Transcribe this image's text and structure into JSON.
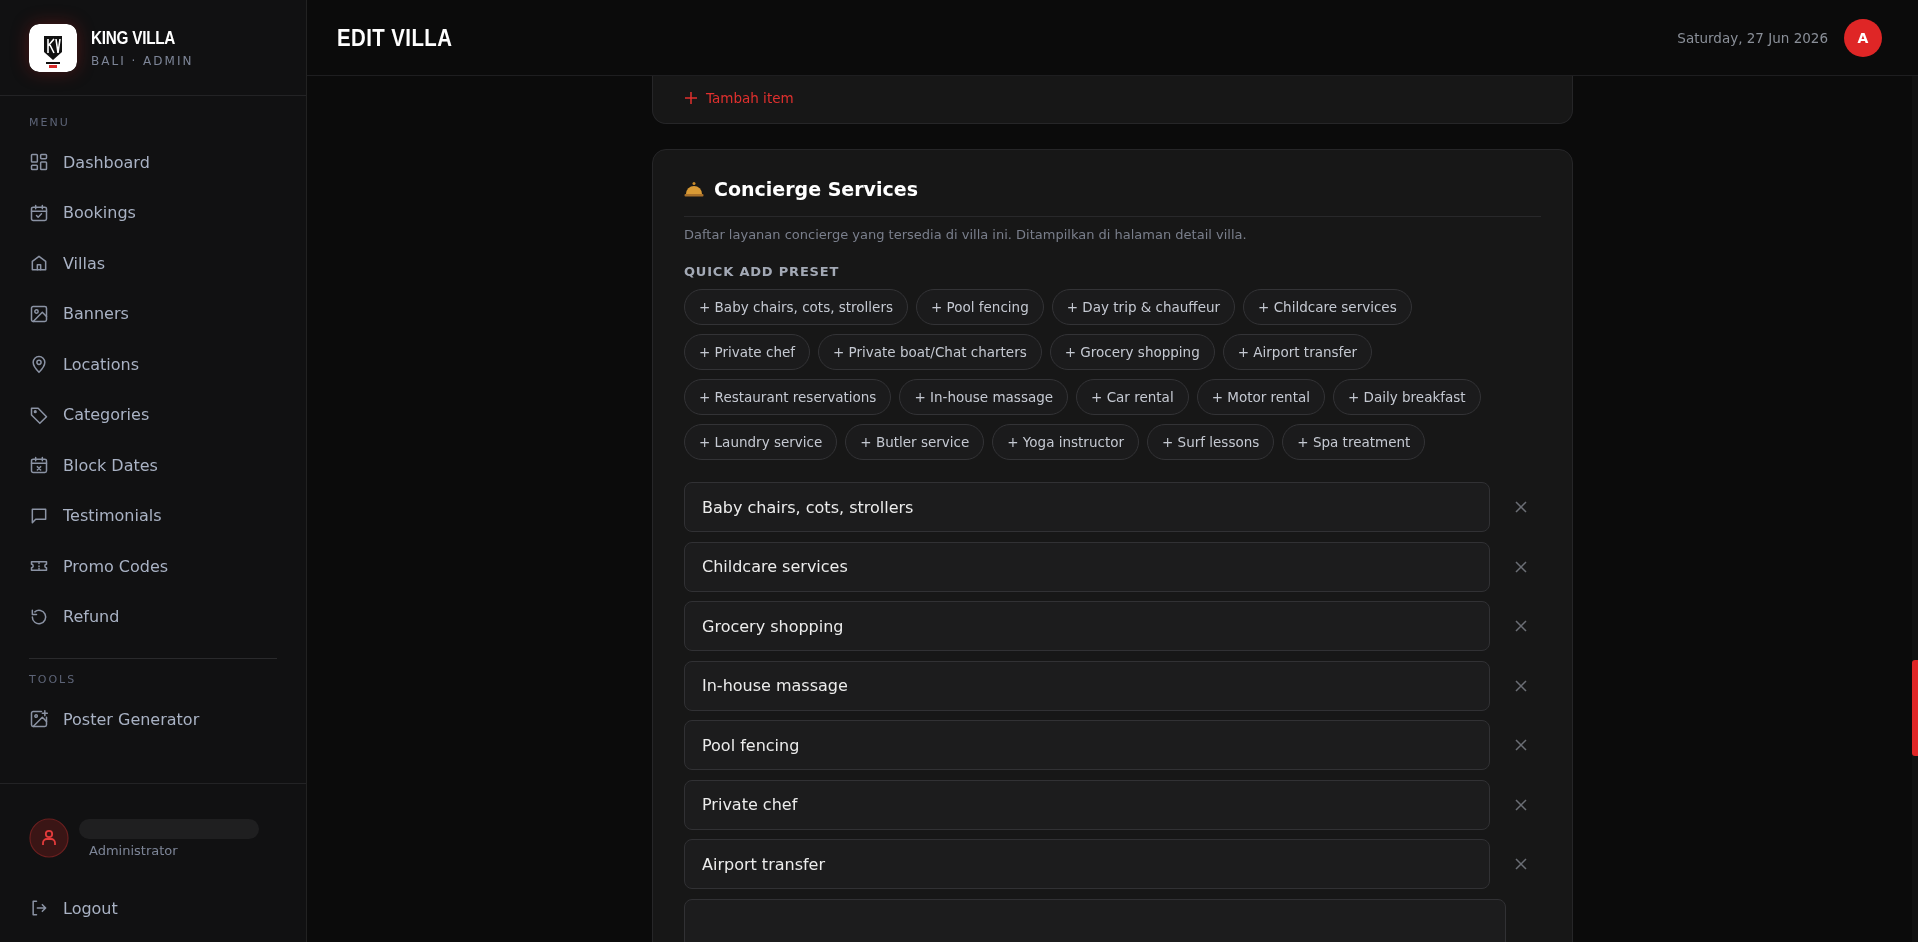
{
  "brand": {
    "name": "KING VILLA",
    "subtitle": "BALI · ADMIN"
  },
  "sidebar": {
    "sections": [
      {
        "label": "MENU",
        "items": [
          {
            "label": "Dashboard",
            "kind": "grid",
            "selected": false
          },
          {
            "label": "Bookings",
            "kind": "calendar",
            "selected": false
          },
          {
            "label": "Villas",
            "kind": "home",
            "selected": false
          },
          {
            "label": "Banners",
            "kind": "image",
            "selected": false
          },
          {
            "label": "Locations",
            "kind": "pin",
            "selected": false
          },
          {
            "label": "Categories",
            "kind": "tag",
            "selected": false
          },
          {
            "label": "Block Dates",
            "kind": "calendarx",
            "selected": false
          },
          {
            "label": "Testimonials",
            "kind": "chat",
            "selected": false
          },
          {
            "label": "Promo Codes",
            "kind": "ticket",
            "selected": false
          },
          {
            "label": "Refund",
            "kind": "refresh",
            "selected": false
          }
        ]
      },
      {
        "label": "TOOLS",
        "items": [
          {
            "label": "Poster Generator",
            "kind": "poster",
            "selected": false
          }
        ]
      }
    ],
    "user": {
      "role": "Administrator"
    },
    "logout": "Logout"
  },
  "header": {
    "title": "EDIT VILLA",
    "date": "Saturday, 27 Jun 2026",
    "avatar": "A"
  },
  "previous_card": {
    "add_button": "Tambah item"
  },
  "concierge": {
    "title": "Concierge Services",
    "description": "Daftar layanan concierge yang tersedia di villa ini. Ditampilkan di halaman detail villa.",
    "preset_label": "QUICK ADD PRESET",
    "presets": [
      "+ Baby chairs, cots, strollers",
      "+ Pool fencing",
      "+ Day trip & chauffeur",
      "+ Childcare services",
      "+ Private chef",
      "+ Private boat/Chat charters",
      "+ Grocery shopping",
      "+ Airport transfer",
      "+ Restaurant reservations",
      "+ In-house massage",
      "+ Car rental",
      "+ Motor rental",
      "+ Daily breakfast",
      "+ Laundry service",
      "+ Butler service",
      "+ Yoga instructor",
      "+ Surf lessons",
      "+ Spa treatment"
    ],
    "items": [
      "Baby chairs, cots, strollers",
      "Childcare services",
      "Grocery shopping",
      "In-house massage",
      "Pool fencing",
      "Private chef",
      "Airport transfer"
    ]
  }
}
